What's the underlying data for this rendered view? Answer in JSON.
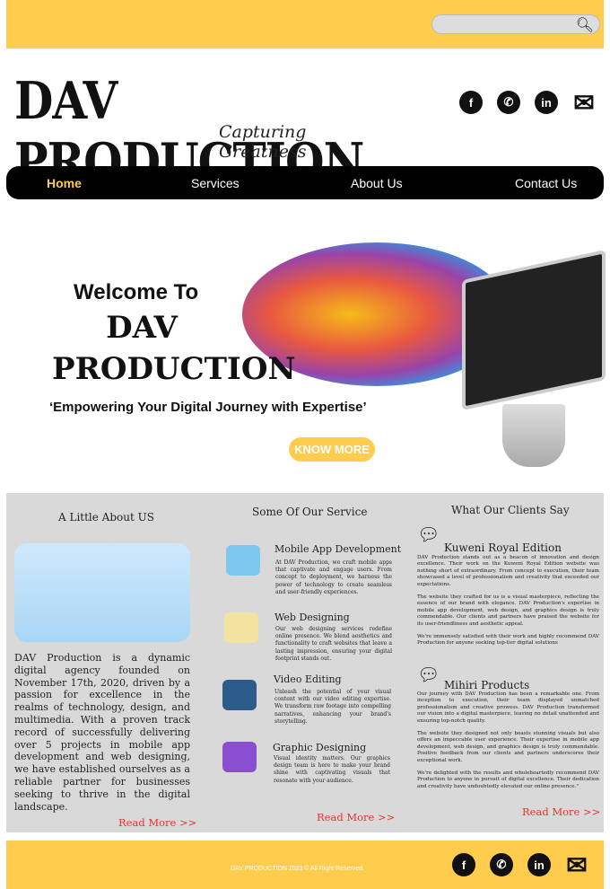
{
  "search": {
    "placeholder": "",
    "icon": "search-icon"
  },
  "brand": {
    "name": "DAV PRODUCTION",
    "tagline": "Capturing Greatness"
  },
  "social": [
    {
      "icon": "facebook-icon",
      "glyph": "f"
    },
    {
      "icon": "whatsapp-icon",
      "glyph": "✆"
    },
    {
      "icon": "linkedin-icon",
      "glyph": "in"
    },
    {
      "icon": "mail-icon",
      "glyph": "✉"
    }
  ],
  "nav": [
    {
      "label": "Home",
      "active": true
    },
    {
      "label": "Services"
    },
    {
      "label": "About Us"
    },
    {
      "label": "Contact Us"
    }
  ],
  "hero": {
    "welcome": "Welcome To",
    "brand_line1": "DAV",
    "brand_line2": "PRODUCTION",
    "tagline": "‘Empowering Your Digital Journey with Expertise’",
    "button": "KNOW MORE"
  },
  "about": {
    "title": "A Little About US",
    "text": "DAV Production is a dynamic digital agency founded on November 17th, 2020, driven by a passion for excellence in the realms of technology, design, and multimedia. With a proven track record of successfully delivering over 5 projects in mobile app development and web designing, we have established ourselves as a reliable partner for businesses seeking to thrive in the digital landscape.",
    "more": "Read More >>"
  },
  "services": {
    "title": "Some Of Our Service",
    "more": "Read More >>",
    "items": [
      {
        "title": "Mobile App Development",
        "text": "At DAV Production, we craft mobile apps that captivate and engage users. From concept to deployment, we harness the power of technology to create seamless and user-friendly experiences."
      },
      {
        "title": "Web Designing",
        "text": "Our web designing services redefine online presence. We blend aesthetics and functionality to craft websites that leave a lasting impression, ensuring your digital footprint stands out."
      },
      {
        "title": "Video Editing",
        "text": "Unleash the potential of your visual content with our video editing expertise. We transform raw footage into compelling narratives, enhancing your brand's storytelling."
      },
      {
        "title": "Graphic Designing",
        "text": "Visual identity matters. Our graphics design team is here to make your brand shine with captivating visuals that resonate with your audience."
      }
    ]
  },
  "reviews": {
    "title": "What Our Clients Say",
    "more": "Read More >>",
    "items": [
      {
        "name": "Kuweni Royal Edition",
        "paras": [
          "DAV Production stands out as a beacon of innovation and design excellence. Their work on the Kuweni Royal Edition website was nothing short of extraordinary. From concept to execution, their team showcased a level of professionalism and creativity that exceeded our expectations.",
          "The website they crafted for us is a visual masterpiece, reflecting the essence of our brand with elegance. DAV Production's expertise in mobile app development, web design, and graphics design is truly commendable. Our clients and partners have praised the website for its user-friendliness and aesthetic appeal.",
          "We're immensely satisfied with their work and highly recommend DAV Production for anyone seeking top-tier digital solutions"
        ]
      },
      {
        "name": "Mihiri Products",
        "paras": [
          "Our journey with DAV Production has been a remarkable one. From inception to execution, their team displayed unmatched professionalism and creative prowess. DAV Production transformed our vision into a digital masterpiece, leaving no detail unattended and ensuring top-notch quality.",
          "The website they designed not only boasts stunning visuals but also offers an impeccable user experience. Their expertise in mobile app development, web design, and graphics design is truly commendable. Positive feedback from our clients and partners underscores their exceptional work.",
          "We're delighted with the results and wholeheartedly recommend DAV Production to anyone in pursuit of digital excellence. Their dedication and creativity have undoubtedly elevated our online presence.\""
        ]
      }
    ]
  },
  "footer": {
    "copyright": "DAV PRODUCTION 2023 © All Right Reserved."
  },
  "colors": {
    "accent": "#ffcc4d",
    "nav": "#000000",
    "section": "#d9d9d9",
    "link": "#e8332b"
  }
}
